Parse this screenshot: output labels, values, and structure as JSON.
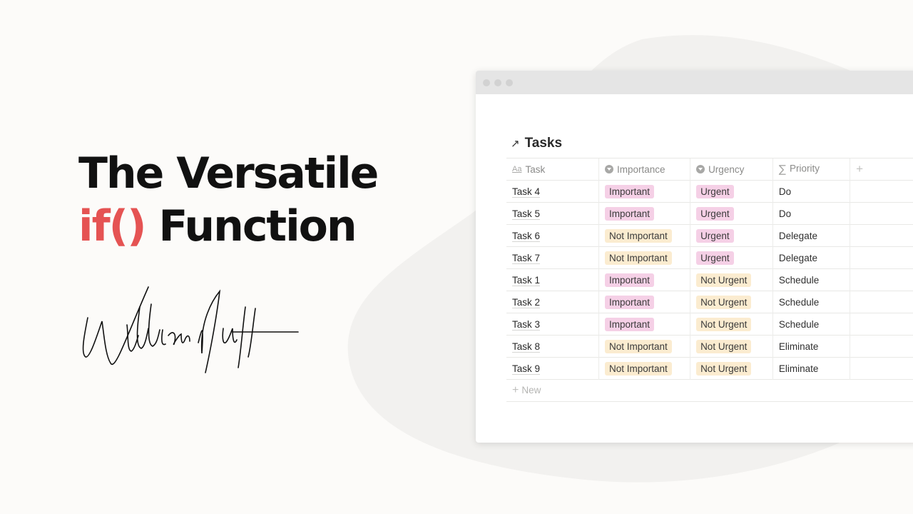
{
  "headline": {
    "line1": "The Versatile",
    "line2_accent": "if()",
    "line2_rest": "Function",
    "accent_color": "#e55353"
  },
  "signature": {
    "author": "William Nutt"
  },
  "window": {
    "title_icon": "arrow-up-right-icon",
    "title": "Tasks",
    "columns": [
      {
        "label": "Task",
        "icon": "text-aa-icon"
      },
      {
        "label": "Importance",
        "icon": "select-icon"
      },
      {
        "label": "Urgency",
        "icon": "select-icon"
      },
      {
        "label": "Priority",
        "icon": "sigma-formula-icon"
      },
      {
        "label": "+",
        "icon": "add-property-icon"
      }
    ],
    "rows": [
      {
        "task": "Task 4",
        "importance": "Important",
        "urgency": "Urgent",
        "priority": "Do"
      },
      {
        "task": "Task 5",
        "importance": "Important",
        "urgency": "Urgent",
        "priority": "Do"
      },
      {
        "task": "Task 6",
        "importance": "Not Important",
        "urgency": "Urgent",
        "priority": "Delegate"
      },
      {
        "task": "Task 7",
        "importance": "Not Important",
        "urgency": "Urgent",
        "priority": "Delegate"
      },
      {
        "task": "Task 1",
        "importance": "Important",
        "urgency": "Not Urgent",
        "priority": "Schedule"
      },
      {
        "task": "Task 2",
        "importance": "Important",
        "urgency": "Not Urgent",
        "priority": "Schedule"
      },
      {
        "task": "Task 3",
        "importance": "Important",
        "urgency": "Not Urgent",
        "priority": "Schedule"
      },
      {
        "task": "Task 8",
        "importance": "Not Important",
        "urgency": "Not Urgent",
        "priority": "Eliminate"
      },
      {
        "task": "Task 9",
        "importance": "Not Important",
        "urgency": "Not Urgent",
        "priority": "Eliminate"
      }
    ],
    "new_label": "New",
    "tag_colors": {
      "Important": "#f5d0e6",
      "Urgent": "#f5d0e6",
      "Not Important": "#fbecd0",
      "Not Urgent": "#fbecd0"
    }
  }
}
